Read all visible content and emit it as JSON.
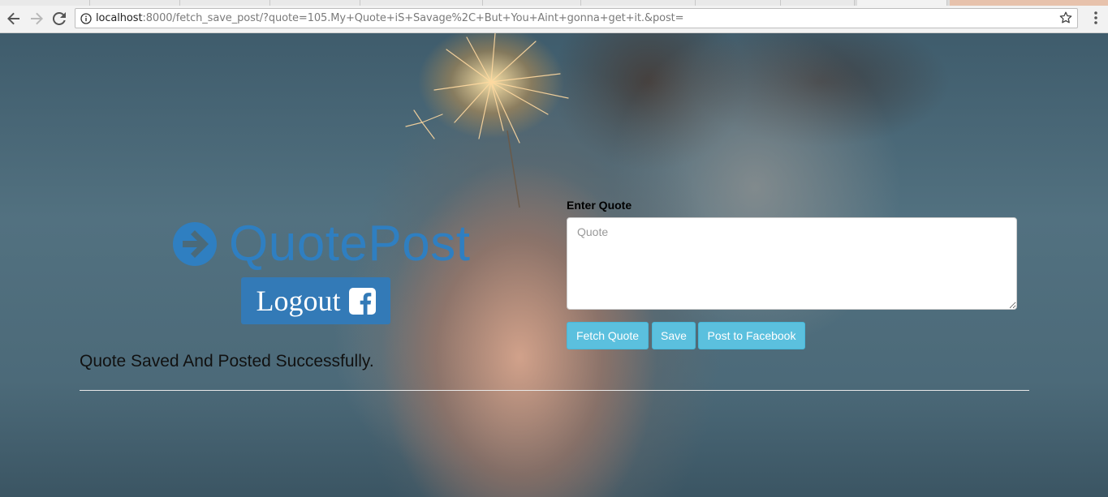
{
  "browser": {
    "url_host": "localhost",
    "url_rest": ":8000/fetch_save_post/?quote=105.My+Quote+iS+Savage%2C+But+You+Aint+gonna+get+it.&post=",
    "icons": [
      "back-icon",
      "forward-icon",
      "reload-icon",
      "info-icon",
      "star-icon",
      "menu-icon"
    ]
  },
  "app": {
    "brand": "QuotePost",
    "logout_label": "Logout",
    "status_message": "Quote Saved And Posted Successfully."
  },
  "form": {
    "label": "Enter Quote",
    "placeholder": "Quote",
    "value": "",
    "buttons": {
      "fetch": "Fetch Quote",
      "save": "Save",
      "post": "Post to Facebook"
    }
  },
  "colors": {
    "brand_blue": "#2f7fc1",
    "logout_bg": "#337ab7",
    "info_button": "#5bc0de"
  }
}
